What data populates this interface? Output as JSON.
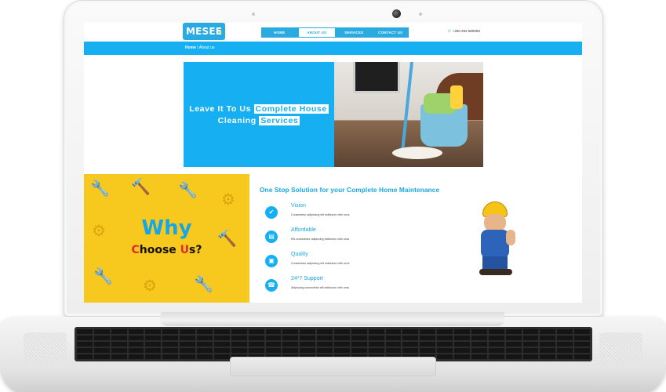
{
  "site": {
    "logo_text": "MESEE",
    "nav": [
      {
        "label": "HOME",
        "active": false
      },
      {
        "label": "ABOUT US",
        "active": true
      },
      {
        "label": "SERVICES",
        "active": false
      },
      {
        "label": "CONTACT US",
        "active": false
      }
    ],
    "phone": "+250 252 580066",
    "breadcrumb": {
      "home": "Home",
      "separator": "|",
      "current": "About us"
    }
  },
  "hero": {
    "line1_plain": "Leave It To Us ",
    "line1_highlight": "Complete House",
    "line2_plain": "Cleaning ",
    "line2_highlight": "Services"
  },
  "why": {
    "title": "Why",
    "sub_c": "C",
    "sub_hoose": "hoose ",
    "sub_u": "U",
    "sub_end": "s?"
  },
  "section_title": "One Stop Solution for your Complete Home Maintenance",
  "features": [
    {
      "title": "Vision",
      "desc": "Consectetur adipiscing elit estibulum nibh urna",
      "icon": "check-icon"
    },
    {
      "title": "Affordable",
      "desc": "Elit consectetur adipiscing estibulum nibh urna",
      "icon": "tag-icon"
    },
    {
      "title": "Quality",
      "desc": "Consectetur adipiscing elit estibulum nibh urna",
      "icon": "image-icon"
    },
    {
      "title": "24*7 Support",
      "desc": "Adipiscing consectetur elit estibulum nibh urna",
      "icon": "support-icon"
    }
  ],
  "colors": {
    "accent": "#16b0f2",
    "yellow": "#f7c81e",
    "red": "#e8262d"
  }
}
